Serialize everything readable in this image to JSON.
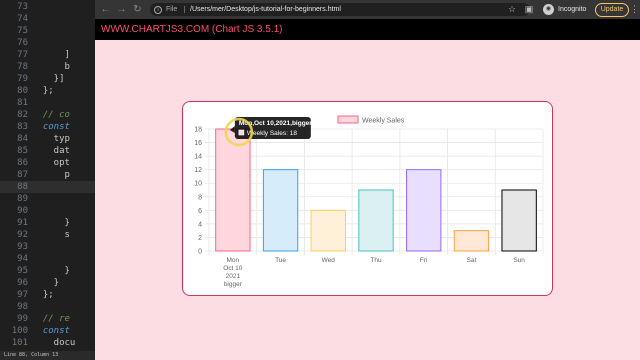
{
  "editor": {
    "lines": [
      {
        "num": "73",
        "code": "",
        "style": ""
      },
      {
        "num": "74",
        "code": "",
        "style": ""
      },
      {
        "num": "75",
        "code": "",
        "style": ""
      },
      {
        "num": "76",
        "code": "",
        "style": ""
      },
      {
        "num": "77",
        "code": "      ]",
        "style": ""
      },
      {
        "num": "78",
        "code": "      b",
        "style": ""
      },
      {
        "num": "79",
        "code": "    }]",
        "style": ""
      },
      {
        "num": "80",
        "code": "  };",
        "style": ""
      },
      {
        "num": "81",
        "code": "",
        "style": ""
      },
      {
        "num": "82",
        "code": "  // co",
        "style": "comment"
      },
      {
        "num": "83",
        "code": "  const",
        "style": "kw"
      },
      {
        "num": "84",
        "code": "    typ",
        "style": ""
      },
      {
        "num": "85",
        "code": "    dat",
        "style": ""
      },
      {
        "num": "86",
        "code": "    opt",
        "style": ""
      },
      {
        "num": "87",
        "code": "      p",
        "style": ""
      },
      {
        "num": "88",
        "code": "",
        "style": ""
      },
      {
        "num": "89",
        "code": "",
        "style": ""
      },
      {
        "num": "90",
        "code": "",
        "style": ""
      },
      {
        "num": "91",
        "code": "      }",
        "style": ""
      },
      {
        "num": "92",
        "code": "      s",
        "style": ""
      },
      {
        "num": "93",
        "code": "",
        "style": ""
      },
      {
        "num": "94",
        "code": "",
        "style": ""
      },
      {
        "num": "95",
        "code": "      }",
        "style": ""
      },
      {
        "num": "96",
        "code": "    }",
        "style": ""
      },
      {
        "num": "97",
        "code": "  };",
        "style": ""
      },
      {
        "num": "98",
        "code": "",
        "style": ""
      },
      {
        "num": "99",
        "code": "  // re",
        "style": "comment"
      },
      {
        "num": "100",
        "code": "  const",
        "style": "kw"
      },
      {
        "num": "101",
        "code": "    docu",
        "style": ""
      }
    ],
    "status": "Line 88, Column 13"
  },
  "browser": {
    "file_label": "File",
    "url": "/Users/mer/Desktop/js-tutorial-for-beginners.html",
    "incognito_label": "Incognito",
    "update_label": "Update"
  },
  "page": {
    "header_title": "WWW.CHARTJS3.COM (Chart JS 3.5.1)"
  },
  "chart_data": {
    "type": "bar",
    "categories": [
      [
        "Mon",
        "Oct 10",
        "2021",
        "bigger"
      ],
      [
        "Tue"
      ],
      [
        "Wed"
      ],
      [
        "Thu"
      ],
      [
        "Fri"
      ],
      [
        "Sat"
      ],
      [
        "Sun"
      ]
    ],
    "series": [
      {
        "name": "Weekly Sales",
        "values": [
          18,
          12,
          6,
          9,
          12,
          3,
          9
        ]
      }
    ],
    "ylim": [
      0,
      18
    ],
    "yticks": [
      0,
      2,
      4,
      6,
      8,
      10,
      12,
      14,
      16,
      18
    ],
    "grid": true,
    "legend_position": "top",
    "bar_fills": [
      "#ffd6de",
      "#d6ecfb",
      "#fff0d9",
      "#dbf1f1",
      "#e8dffe",
      "#ffe8d6",
      "#e6e6e6"
    ],
    "bar_strokes": [
      "#ff6384",
      "#36a2eb",
      "#ffce56",
      "#4bc0c0",
      "#9966ff",
      "#ff9f40",
      "#000000"
    ],
    "tooltip": {
      "title": "Mon,Oct 10,2021,bigger",
      "body": "Weekly Sales: 18"
    }
  }
}
